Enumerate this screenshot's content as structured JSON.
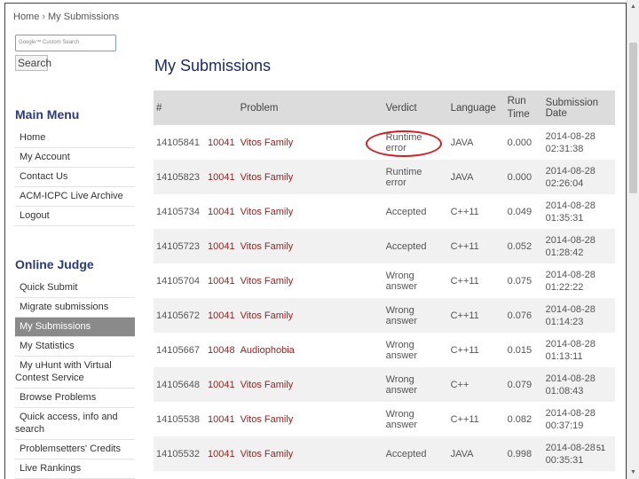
{
  "breadcrumb": {
    "home": "Home",
    "separator": "›",
    "current": "My Submissions"
  },
  "search": {
    "placeholder": "Google™ Custom Search",
    "button_label": "Search"
  },
  "main_menu": {
    "title": "Main Menu",
    "items": [
      "Home",
      "My Account",
      "Contact Us",
      "ACM-ICPC Live Archive",
      "Logout"
    ]
  },
  "online_judge": {
    "title": "Online Judge",
    "items": [
      {
        "label": "Quick Submit"
      },
      {
        "label": "Migrate submissions"
      },
      {
        "label": "My Submissions",
        "active": true
      },
      {
        "label": "My Statistics"
      },
      {
        "label": "My uHunt with Virtual",
        "label2": "Contest Service"
      },
      {
        "label": "Browse Problems"
      },
      {
        "label": "Quick access, info and",
        "label2": "search"
      },
      {
        "label": "Problemsetters' Credits"
      },
      {
        "label": "Live Rankings"
      }
    ]
  },
  "page_title": "My Submissions",
  "table": {
    "headers": {
      "id": "#",
      "problem": "Problem",
      "verdict": "Verdict",
      "language": "Language",
      "run_time_1": "Run",
      "run_time_2": "Time",
      "date": "Submission Date"
    },
    "rows": [
      {
        "id": "14105841",
        "pnum": "10041",
        "pname": "Vitos Family",
        "verdict": "Runtime error",
        "lang": "JAVA",
        "time": "0.000",
        "date": "2014-08-28",
        "clock": "02:31:38"
      },
      {
        "id": "14105823",
        "pnum": "10041",
        "pname": "Vitos Family",
        "verdict": "Runtime error",
        "lang": "JAVA",
        "time": "0.000",
        "date": "2014-08-28",
        "clock": "02:26:04"
      },
      {
        "id": "14105734",
        "pnum": "10041",
        "pname": "Vitos Family",
        "verdict": "Accepted",
        "lang": "C++11",
        "time": "0.049",
        "date": "2014-08-28",
        "clock": "01:35:31"
      },
      {
        "id": "14105723",
        "pnum": "10041",
        "pname": "Vitos Family",
        "verdict": "Accepted",
        "lang": "C++11",
        "time": "0.052",
        "date": "2014-08-28",
        "clock": "01:28:42"
      },
      {
        "id": "14105704",
        "pnum": "10041",
        "pname": "Vitos Family",
        "verdict": "Wrong answer",
        "lang": "C++11",
        "time": "0.075",
        "date": "2014-08-28",
        "clock": "01:22:22"
      },
      {
        "id": "14105672",
        "pnum": "10041",
        "pname": "Vitos Family",
        "verdict": "Wrong answer",
        "lang": "C++11",
        "time": "0.076",
        "date": "2014-08-28",
        "clock": "01:14:23"
      },
      {
        "id": "14105667",
        "pnum": "10048",
        "pname": "Audiophobia",
        "verdict": "Wrong answer",
        "lang": "C++11",
        "time": "0.015",
        "date": "2014-08-28",
        "clock": "01:13:11"
      },
      {
        "id": "14105648",
        "pnum": "10041",
        "pname": "Vitos Family",
        "verdict": "Wrong answer",
        "lang": "C++",
        "time": "0.079",
        "date": "2014-08-28",
        "clock": "01:08:43"
      },
      {
        "id": "14105538",
        "pnum": "10041",
        "pname": "Vitos Family",
        "verdict": "Wrong answer",
        "lang": "C++11",
        "time": "0.082",
        "date": "2014-08-28",
        "clock": "00:37:19"
      },
      {
        "id": "14105532",
        "pnum": "10041",
        "pname": "Vitos Family",
        "verdict": "Accepted",
        "lang": "JAVA",
        "time": "0.998",
        "date": "2014-08-28",
        "clock": "00:35:31"
      }
    ]
  },
  "slide_number": "51",
  "colors": {
    "accent": "#2b3a7a",
    "problem_link": "#9c1c1c",
    "highlight_circle": "#d61c1c",
    "active_item": "#8a8a8a"
  }
}
